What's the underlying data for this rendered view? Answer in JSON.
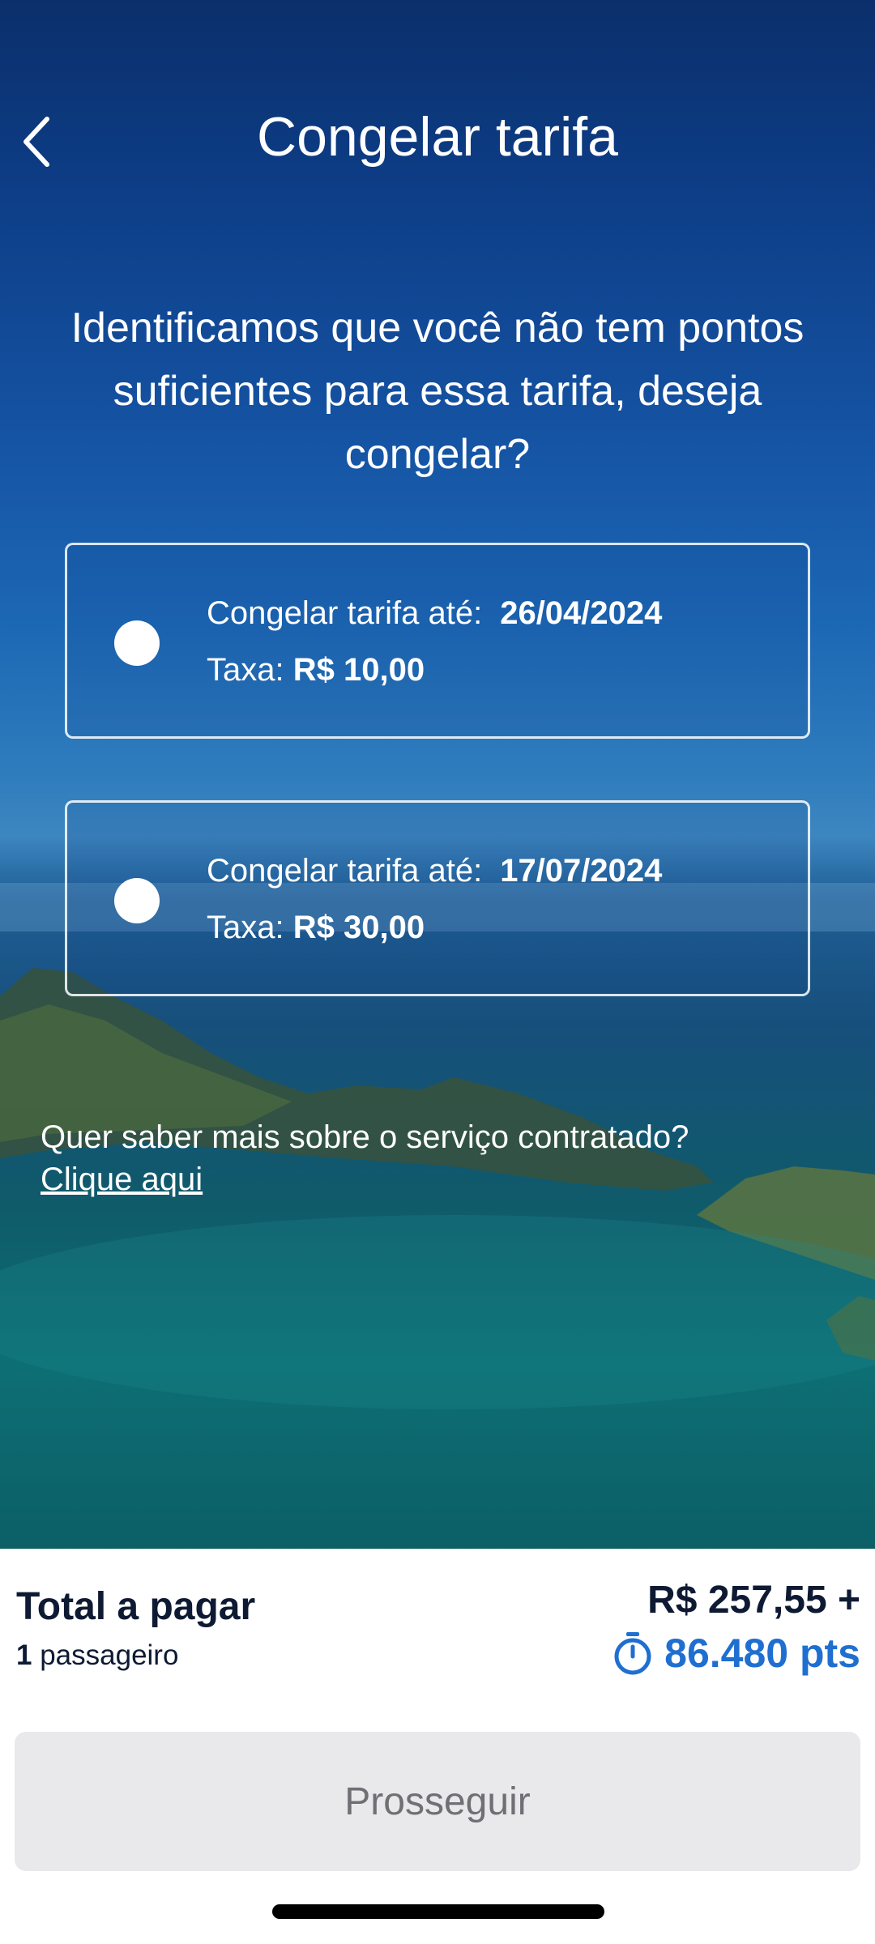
{
  "header": {
    "title": "Congelar tarifa"
  },
  "prompt": {
    "text": "Identificamos que você não tem pontos suficientes para essa tarifa, deseja congelar?"
  },
  "options": [
    {
      "label": "Congelar tarifa até:",
      "date": "26/04/2024",
      "fee_label": "Taxa:",
      "fee": "R$ 10,00",
      "selected": false
    },
    {
      "label": "Congelar tarifa até:",
      "date": "17/07/2024",
      "fee_label": "Taxa:",
      "fee": "R$ 30,00",
      "selected": false
    }
  ],
  "info": {
    "question": "Quer saber mais sobre o serviço contratado?",
    "link": "Clique aqui"
  },
  "footer": {
    "total_label": "Total a pagar",
    "passenger_count": "1",
    "passenger_label": "passageiro",
    "price": "R$ 257,55 +",
    "points": "86.480 pts",
    "points_icon": "stopwatch-icon",
    "button_label": "Prosseguir"
  },
  "colors": {
    "points_blue": "#1f6fd1",
    "text_dark": "#0e1a33",
    "button_bg": "#e9e9ec"
  }
}
